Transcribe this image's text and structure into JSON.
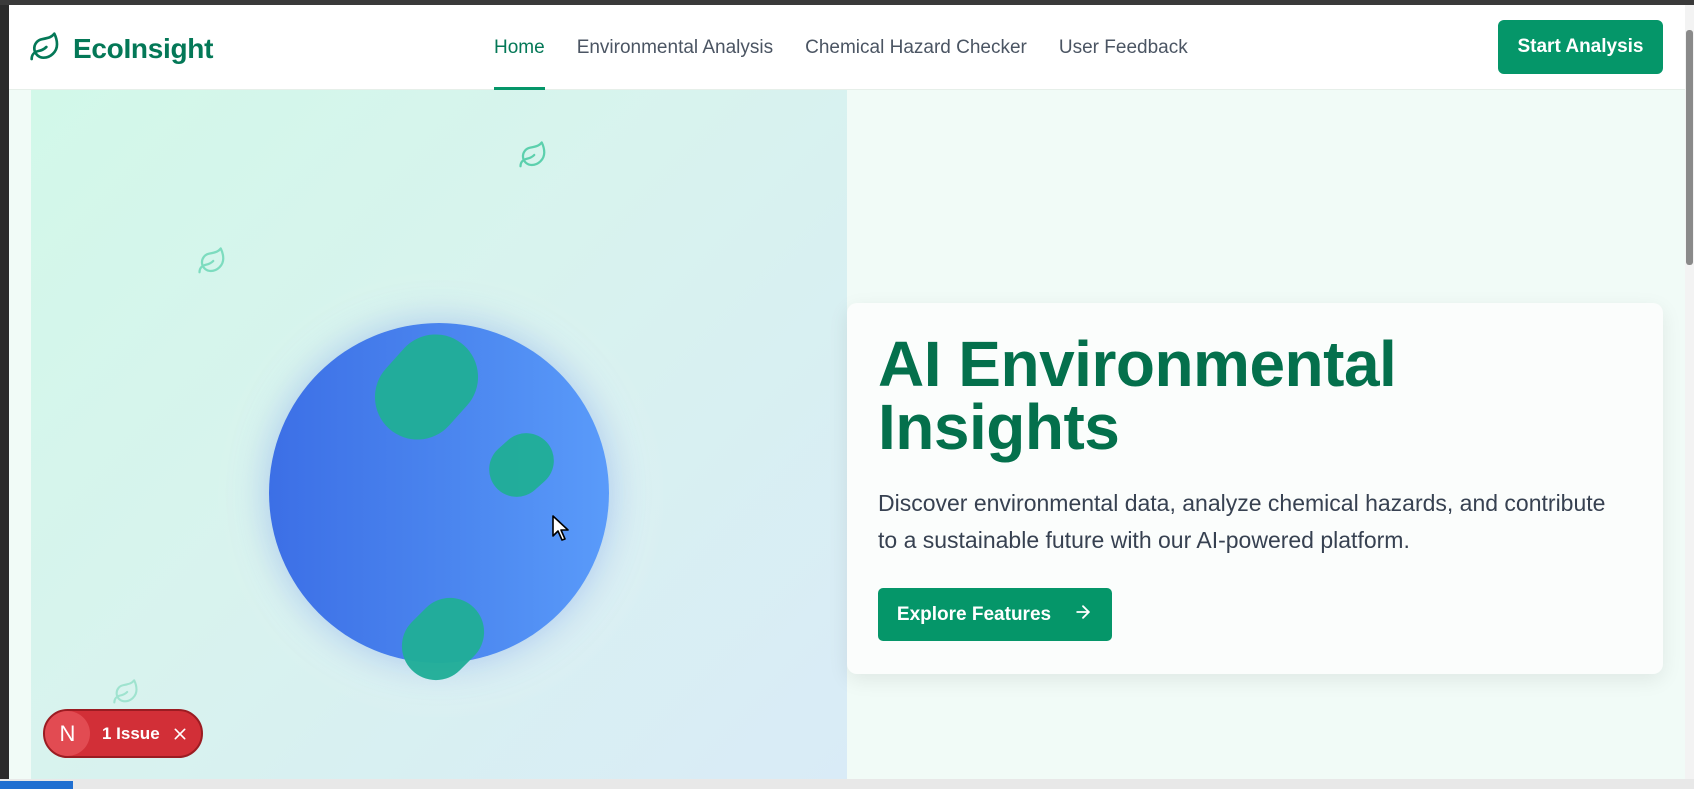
{
  "brand": {
    "name": "EcoInsight",
    "icon": "leaf-icon"
  },
  "nav": {
    "items": [
      {
        "label": "Home",
        "active": true
      },
      {
        "label": "Environmental Analysis",
        "active": false
      },
      {
        "label": "Chemical Hazard Checker",
        "active": false
      },
      {
        "label": "User Feedback",
        "active": false
      }
    ]
  },
  "header": {
    "cta_label": "Start Analysis"
  },
  "hero": {
    "title": "AI Environmental Insights",
    "description": "Discover environmental data, analyze chemical hazards, and contribute to a sustainable future with our AI-powered platform.",
    "button_label": "Explore Features",
    "button_icon": "arrow-right-icon"
  },
  "issue_badge": {
    "letter": "N",
    "label": "1 Issue",
    "close_icon": "close-icon"
  },
  "colors": {
    "brand": "#047857",
    "primary_button": "#059669",
    "globe": "#4b86ef",
    "land": "#21ad98",
    "issue": "#d22f37"
  }
}
